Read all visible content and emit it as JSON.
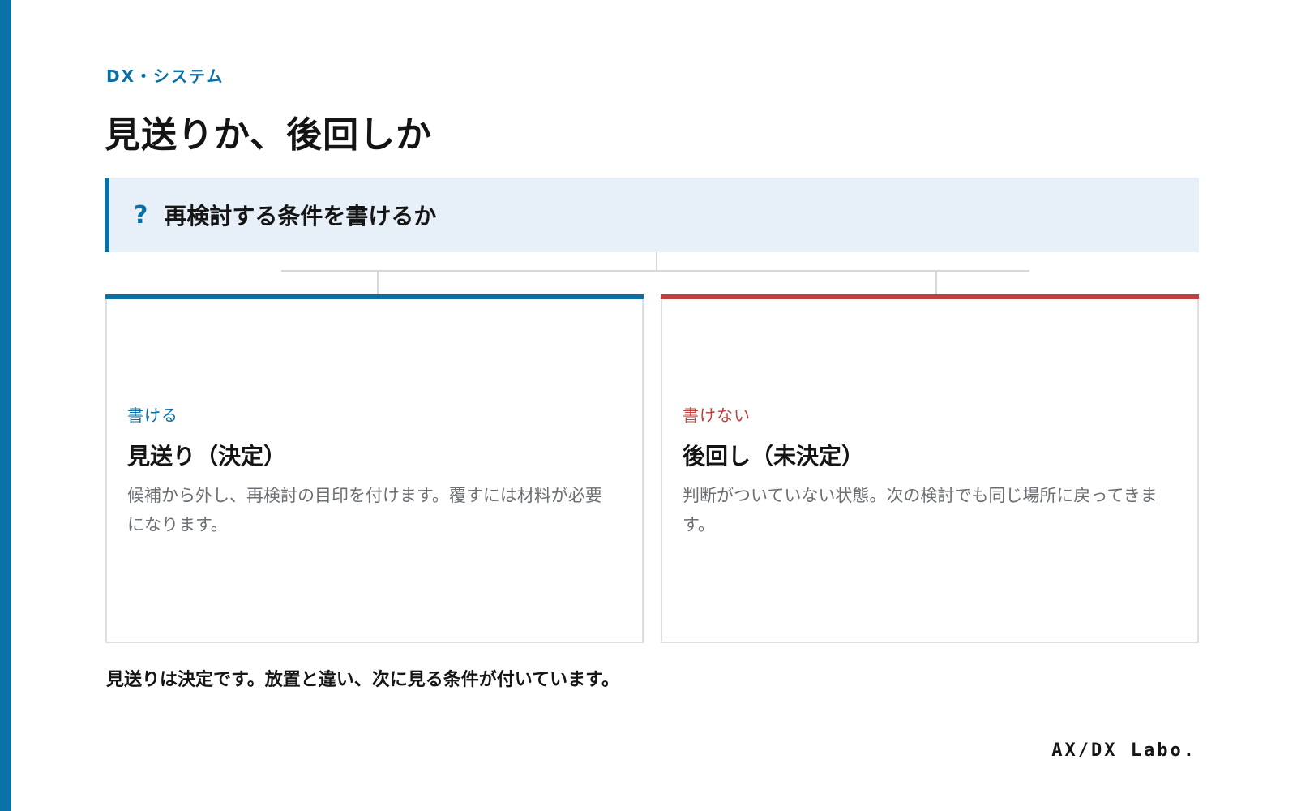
{
  "header": {
    "category": "DX・システム",
    "title": "見送りか、後回しか"
  },
  "question": {
    "icon": "question-mark-icon",
    "mark": "?",
    "text": "再検討する条件を書けるか"
  },
  "branches": [
    {
      "tag": "書ける",
      "heading": "見送り（決定）",
      "description": "候補から外し、再検討の目印を付けます。覆すには材料が必要になります。",
      "color": "#0b6fa4"
    },
    {
      "tag": "書けない",
      "heading": "後回し（未決定）",
      "description": "判断がついていない状態。次の検討でも同じ場所に戻ってきます。",
      "color": "#c0403c"
    }
  ],
  "conclusion": "見送りは決定です。放置と違い、次に見る条件が付いています。",
  "brand": "AX/DX Labo.",
  "colors": {
    "accent": "#0b6fa4",
    "negative": "#c0403c",
    "question_bg": "#e7f0f8"
  }
}
